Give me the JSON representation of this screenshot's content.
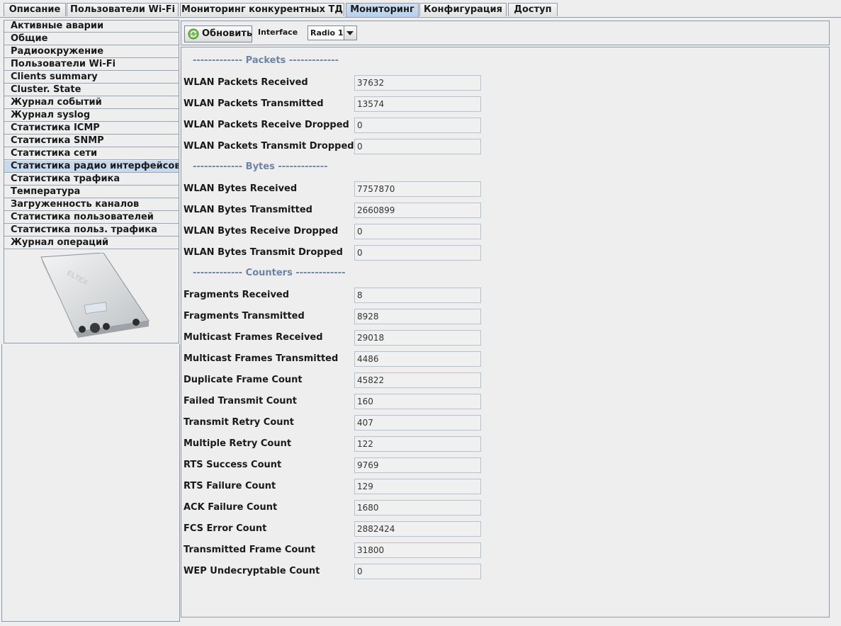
{
  "tabs": [
    {
      "label": "Описание"
    },
    {
      "label": "Пользователи Wi-Fi"
    },
    {
      "label": "Мониторинг конкурентных ТД"
    },
    {
      "label": "Мониторинг"
    },
    {
      "label": "Конфигурация"
    },
    {
      "label": "Доступ"
    }
  ],
  "sidebar": {
    "items": [
      {
        "label": "Активные аварии"
      },
      {
        "label": "Общие"
      },
      {
        "label": "Радиоокружение"
      },
      {
        "label": "Пользователи Wi-Fi"
      },
      {
        "label": "Clients summary"
      },
      {
        "label": "Cluster. State"
      },
      {
        "label": "Журнал событий"
      },
      {
        "label": "Журнал syslog"
      },
      {
        "label": "Статистика ICMP"
      },
      {
        "label": "Статистика SNMP"
      },
      {
        "label": "Статистика сети"
      },
      {
        "label": "Статистика радио интерфейсов"
      },
      {
        "label": "Статистика трафика"
      },
      {
        "label": "Температура"
      },
      {
        "label": "Загруженность каналов"
      },
      {
        "label": "Статистика пользователей"
      },
      {
        "label": "Статистика польз. трафика"
      },
      {
        "label": "Журнал операций"
      }
    ],
    "active_index": 11,
    "device_logo_text": "ELTEX"
  },
  "toolbar": {
    "refresh_label": "Обновить",
    "interface_label": "Interface",
    "interface_value": "Radio 1"
  },
  "sections": [
    {
      "title": "------------- Packets -------------",
      "rows": [
        {
          "label": "WLAN Packets Received",
          "value": "37632"
        },
        {
          "label": "WLAN Packets Transmitted",
          "value": "13574"
        },
        {
          "label": "WLAN Packets Receive Dropped",
          "value": "0"
        },
        {
          "label": "WLAN Packets Transmit Dropped",
          "value": "0"
        }
      ]
    },
    {
      "title": "------------- Bytes -------------",
      "rows": [
        {
          "label": "WLAN Bytes Received",
          "value": "7757870"
        },
        {
          "label": "WLAN Bytes Transmitted",
          "value": "2660899"
        },
        {
          "label": "WLAN Bytes Receive Dropped",
          "value": "0"
        },
        {
          "label": "WLAN Bytes Transmit Dropped",
          "value": "0"
        }
      ]
    },
    {
      "title": "------------- Counters -------------",
      "rows": [
        {
          "label": "Fragments Received",
          "value": "8"
        },
        {
          "label": "Fragments Transmitted",
          "value": "8928"
        },
        {
          "label": "Multicast Frames Received",
          "value": "29018"
        },
        {
          "label": "Multicast Frames Transmitted",
          "value": "4486"
        },
        {
          "label": "Duplicate Frame Count",
          "value": "45822"
        },
        {
          "label": "Failed Transmit Count",
          "value": "160"
        },
        {
          "label": "Transmit Retry Count",
          "value": "407"
        },
        {
          "label": "Multiple Retry Count",
          "value": "122"
        },
        {
          "label": "RTS Success Count",
          "value": "9769"
        },
        {
          "label": "RTS Failure Count",
          "value": "129"
        },
        {
          "label": "ACK Failure Count",
          "value": "1680"
        },
        {
          "label": "FCS Error Count",
          "value": "2882424"
        },
        {
          "label": "Transmitted Frame Count",
          "value": "31800"
        },
        {
          "label": "WEP Undecryptable Count",
          "value": "0"
        }
      ]
    }
  ]
}
